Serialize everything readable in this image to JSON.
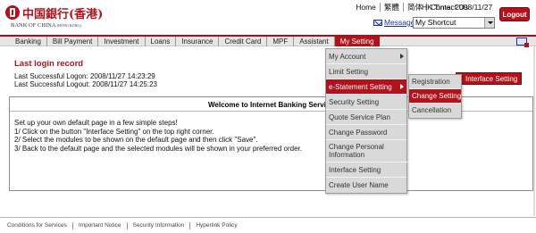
{
  "brand": {
    "name_cn": "中国銀行(香港)",
    "name_en": "BANK OF CHINA",
    "name_en_small": "(HONG KONG)",
    "color": "#b3121c"
  },
  "top_links": [
    "Home",
    "繁體",
    "简体",
    "Contact Us"
  ],
  "hk_time": "HK Time: 2008/11/27",
  "logout_label": "Logout",
  "message_label": "Message",
  "shortcut": {
    "selected": "My Shortcut"
  },
  "nav": {
    "items": [
      "Banking",
      "Bill Payment",
      "Investment",
      "Loans",
      "Insurance",
      "Credit Card",
      "MPF",
      "Assistant",
      "My Setting"
    ],
    "active": "My Setting"
  },
  "last_login": {
    "title": "Last login record",
    "successful_logon": "Last Successful Logon: 2008/11/27 14:23:29",
    "successful_logout": "Last Successful Logout: 2008/11/27 14:25:23"
  },
  "welcome": {
    "title": "Welcome to Internet Banking Service",
    "steps": [
      "Set up your own default page in a few simple steps!",
      "1/ Click on the button \"Interface Setting\" on the top right corner.",
      "2/ Select the modules to be shown on the default page and then click \"Save\".",
      "3/ Back to the default page and the selected modules will be shown in your preferred order."
    ]
  },
  "interface_setting_button": "Interface Setting",
  "dropdown": {
    "items": [
      "My Account",
      "Limit Setting",
      "e-Statement Setting",
      "Security Setting",
      "Quote Service Plan",
      "Change Password",
      "Change Personal Information",
      "Interface Setting",
      "Create User Name"
    ],
    "highlighted": "e-Statement Setting",
    "submenu": [
      "Registration",
      "Change Setting",
      "Cancellation"
    ],
    "submenu_highlighted": "Change Setting"
  },
  "footer": [
    "Conditions for Services",
    "Important Notice",
    "Security Information",
    "Hyperlink Policy"
  ]
}
